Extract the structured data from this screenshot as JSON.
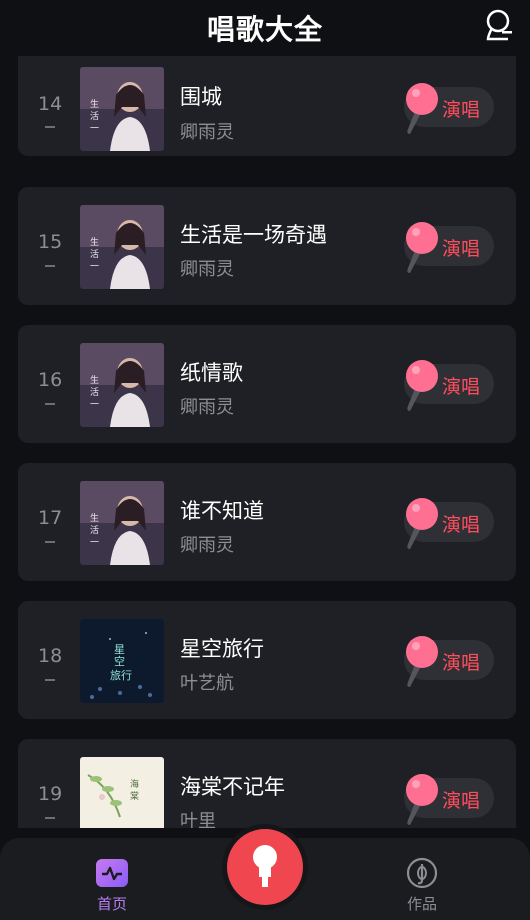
{
  "header": {
    "title": "唱歌大全",
    "user_icon": "user-icon"
  },
  "songs": [
    {
      "rank": "14",
      "title": "围城",
      "artist": "卿雨灵",
      "cover": "portrait"
    },
    {
      "rank": "15",
      "title": "生活是一场奇遇",
      "artist": "卿雨灵",
      "cover": "portrait"
    },
    {
      "rank": "16",
      "title": "纸情歌",
      "artist": "卿雨灵",
      "cover": "portrait"
    },
    {
      "rank": "17",
      "title": "谁不知道",
      "artist": "卿雨灵",
      "cover": "portrait"
    },
    {
      "rank": "18",
      "title": "星空旅行",
      "artist": "叶艺航",
      "cover": "starry"
    },
    {
      "rank": "19",
      "title": "海棠不记年",
      "artist": "叶里",
      "cover": "floral"
    }
  ],
  "sing_label": "演唱",
  "tabbar": {
    "home_label": "首页",
    "works_label": "作品",
    "active_color": "#b57ff0",
    "inactive_color": "#8d8e93"
  },
  "colors": {
    "accent": "#ff4d5c",
    "mic_pink": "#ff6f92",
    "center_button": "#f0464f"
  }
}
